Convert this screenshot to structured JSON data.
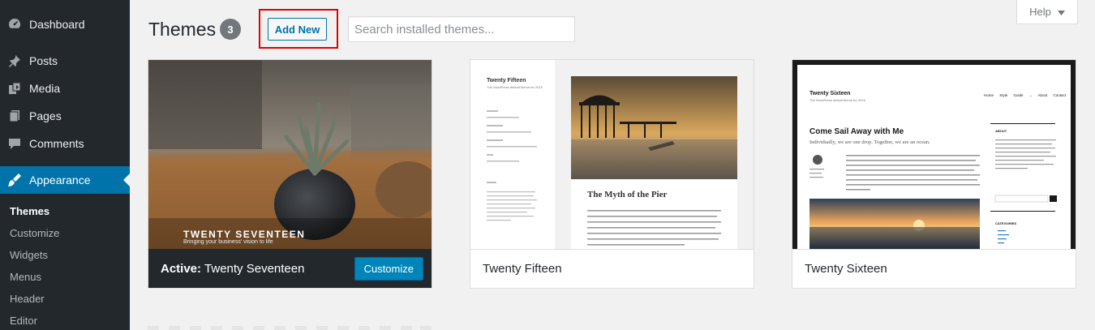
{
  "sidebar": {
    "items": [
      {
        "label": "Dashboard",
        "icon": "dashboard-icon"
      },
      {
        "label": "Posts",
        "icon": "pushpin-icon"
      },
      {
        "label": "Media",
        "icon": "media-icon"
      },
      {
        "label": "Pages",
        "icon": "pages-icon"
      },
      {
        "label": "Comments",
        "icon": "comment-icon"
      },
      {
        "label": "Appearance",
        "icon": "paintbrush-icon"
      }
    ],
    "submenu": [
      "Themes",
      "Customize",
      "Widgets",
      "Menus",
      "Header",
      "Editor"
    ]
  },
  "header": {
    "title": "Themes",
    "count": "3",
    "add_new_label": "Add New",
    "search_placeholder": "Search installed themes...",
    "help_label": "Help"
  },
  "themes": [
    {
      "name": "Twenty Seventeen",
      "active_prefix": "Active:",
      "customize_label": "Customize",
      "screenshot_title": "TWENTY SEVENTEEN",
      "screenshot_tagline": "Bringing your business' vision to life"
    },
    {
      "name": "Twenty Fifteen",
      "screenshot_site": "Twenty Fifteen",
      "screenshot_desc": "The WordPress default theme for 2015",
      "screenshot_post_title": "The Myth of the Pier"
    },
    {
      "name": "Twenty Sixteen",
      "screenshot_site": "Twenty Sixteen",
      "screenshot_desc": "The WordPress default theme for 2016",
      "screenshot_nav": "Home  Style Guide ⌄  About  Contact",
      "screenshot_post_title": "Come Sail Away with Me",
      "screenshot_post_excerpt": "Individually, we are one drop. Together, we are an ocean.",
      "widget_about": "ABOUT",
      "widget_categories": "CATEGORIES"
    }
  ],
  "colors": {
    "sidebar_bg": "#23282d",
    "accent": "#0073aa",
    "button_primary": "#0085ba",
    "highlight": "#e00000"
  }
}
